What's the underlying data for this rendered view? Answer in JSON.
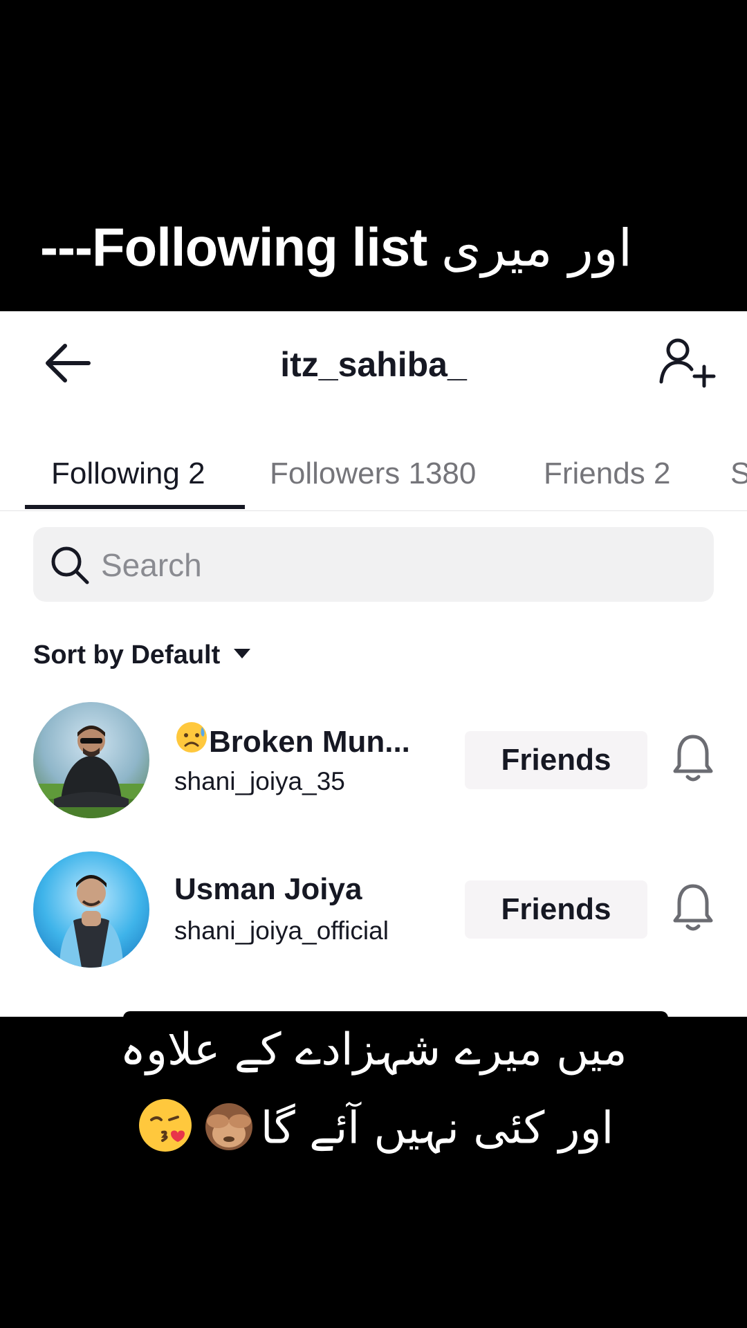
{
  "caption_top": {
    "prefix": "---",
    "english": "Following list",
    "urdu": "اور میری"
  },
  "nav": {
    "title": "itz_sahiba_"
  },
  "tabs": [
    {
      "label": "Following 2",
      "active": true
    },
    {
      "label": "Followers 1380",
      "active": false
    },
    {
      "label": "Friends 2",
      "active": false
    },
    {
      "label": "S",
      "active": false
    }
  ],
  "search": {
    "placeholder": "Search",
    "value": ""
  },
  "sort": {
    "label": "Sort by Default"
  },
  "users": [
    {
      "name": "Broken Mun...",
      "handle": "shani_joiya_35",
      "button_label": "Friends",
      "emoji": "sad-sweat-face"
    },
    {
      "name": "Usman Joiya",
      "handle": "shani_joiya_official",
      "button_label": "Friends"
    }
  ],
  "caption_bottom": {
    "line1": "میں میرے شہزادے کے علاوہ",
    "line2": "اور کئی نہیں آئے گا"
  },
  "colors": {
    "text_primary": "#161823",
    "text_secondary": "#75757a",
    "button_bg": "#f6f4f6",
    "search_bg": "#f1f1f2"
  }
}
